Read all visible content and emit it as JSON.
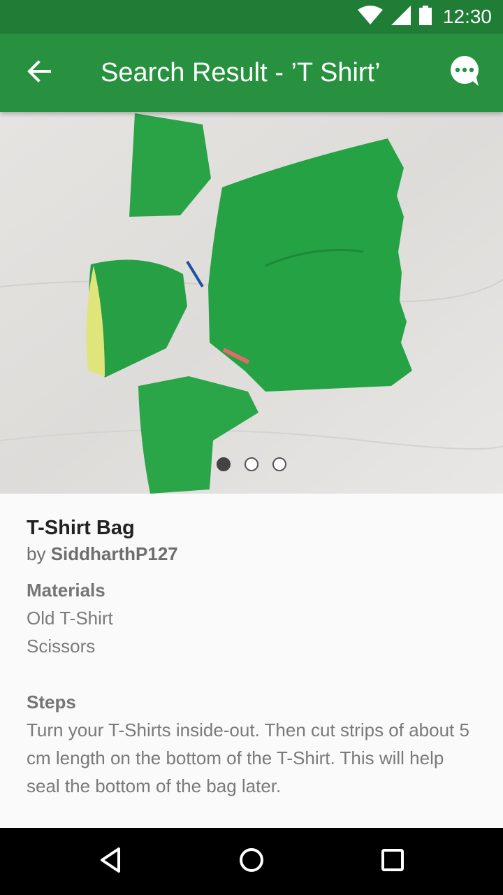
{
  "status_bar": {
    "time": "12:30",
    "icons": [
      "wifi-icon",
      "cell-signal-icon",
      "battery-icon"
    ]
  },
  "app_bar": {
    "title": "Search Result - ’T Shirt’",
    "back_icon": "arrow-left-icon",
    "chat_icon": "chat-bubble-icon",
    "color": "#27913f",
    "status_color": "#1f7d36"
  },
  "carousel": {
    "page_count": 3,
    "active_index": 0
  },
  "project": {
    "title": "T-Shirt Bag",
    "by_prefix": "by",
    "author": "SiddharthP127",
    "materials_heading": "Materials",
    "materials": [
      "Old T-Shirt",
      "Scissors"
    ],
    "steps_heading": "Steps",
    "steps_text": "Turn your T-Shirts inside-out. Then cut strips of about 5 cm length on the bottom of the T-Shirt. This will help seal the bottom of the bag later."
  },
  "nav_bar": {
    "icons": [
      "back-triangle-icon",
      "home-circle-icon",
      "recents-square-icon"
    ]
  }
}
